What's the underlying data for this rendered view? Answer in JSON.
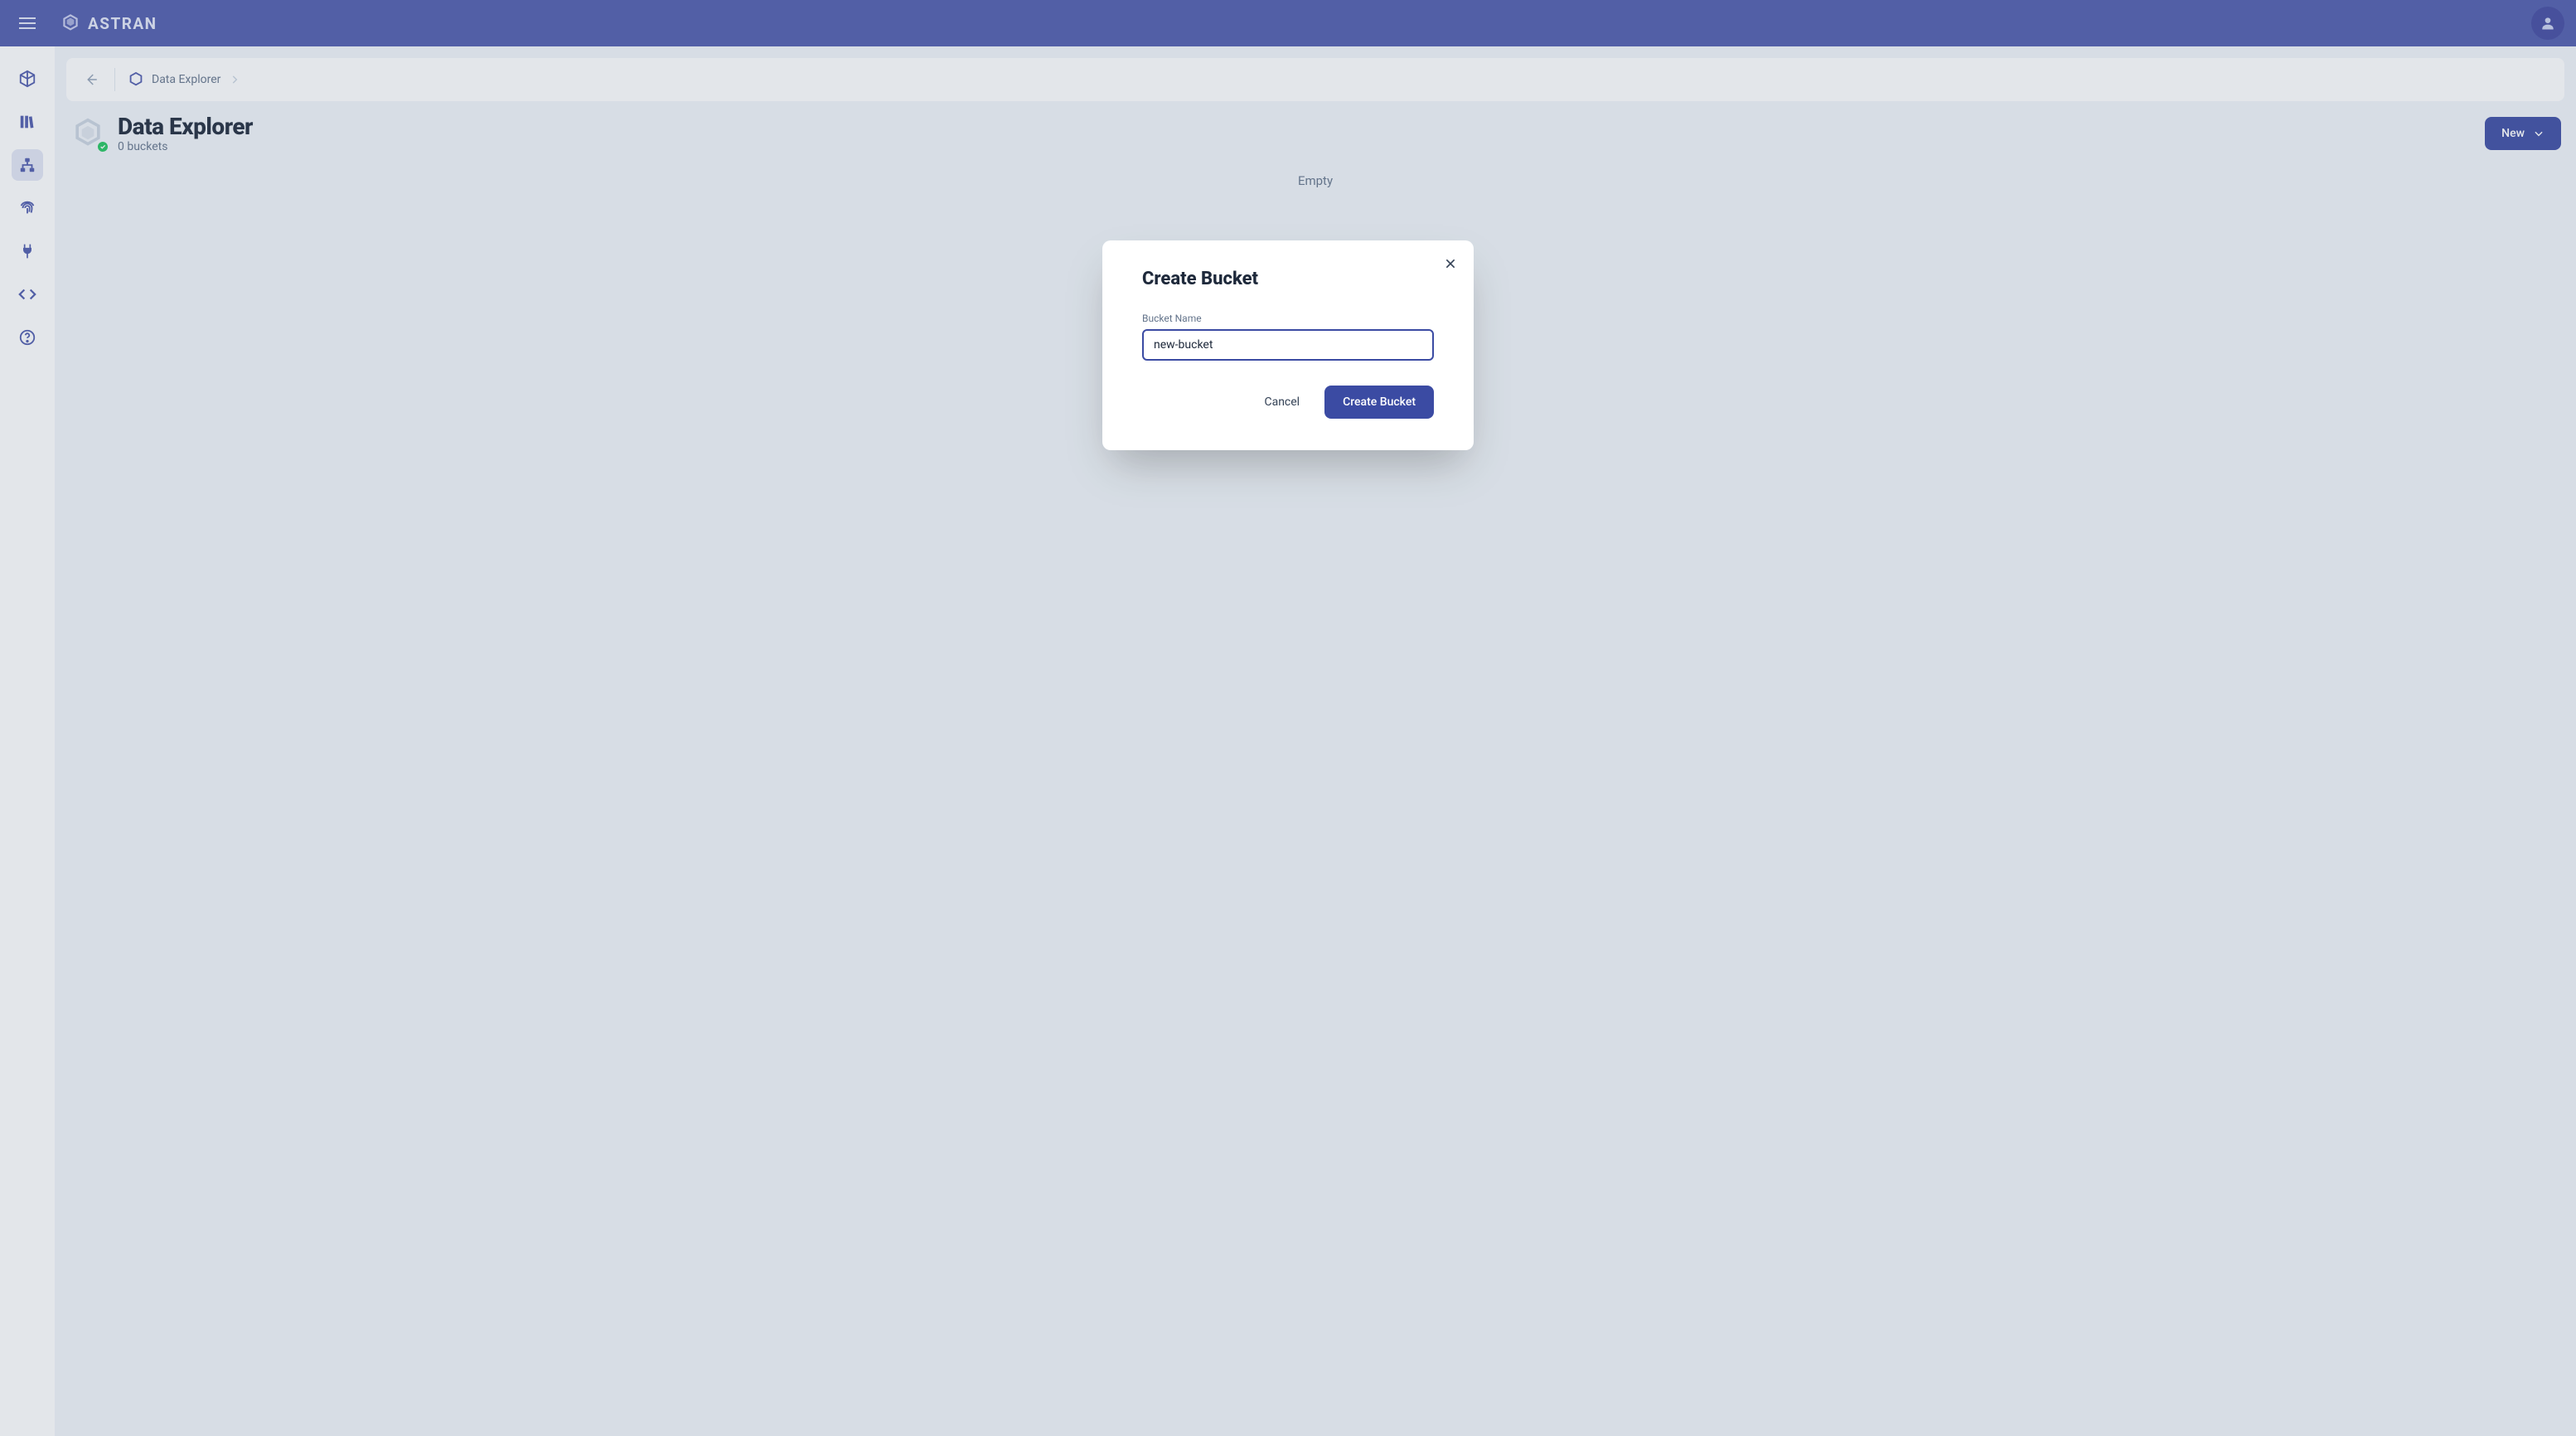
{
  "brand": {
    "name": "ASTRAN"
  },
  "sidebar": {
    "items": [
      {
        "name": "cube"
      },
      {
        "name": "library"
      },
      {
        "name": "data-explorer"
      },
      {
        "name": "fingerprint"
      },
      {
        "name": "plug"
      },
      {
        "name": "code"
      },
      {
        "name": "help"
      }
    ]
  },
  "breadcrumb": {
    "root": "Data Explorer"
  },
  "page": {
    "title": "Data Explorer",
    "subtitle": "0 buckets",
    "empty_text": "Empty",
    "new_button": "New"
  },
  "modal": {
    "title": "Create Bucket",
    "field_label": "Bucket Name",
    "field_value": "new-bucket",
    "cancel_label": "Cancel",
    "confirm_label": "Create Bucket"
  }
}
